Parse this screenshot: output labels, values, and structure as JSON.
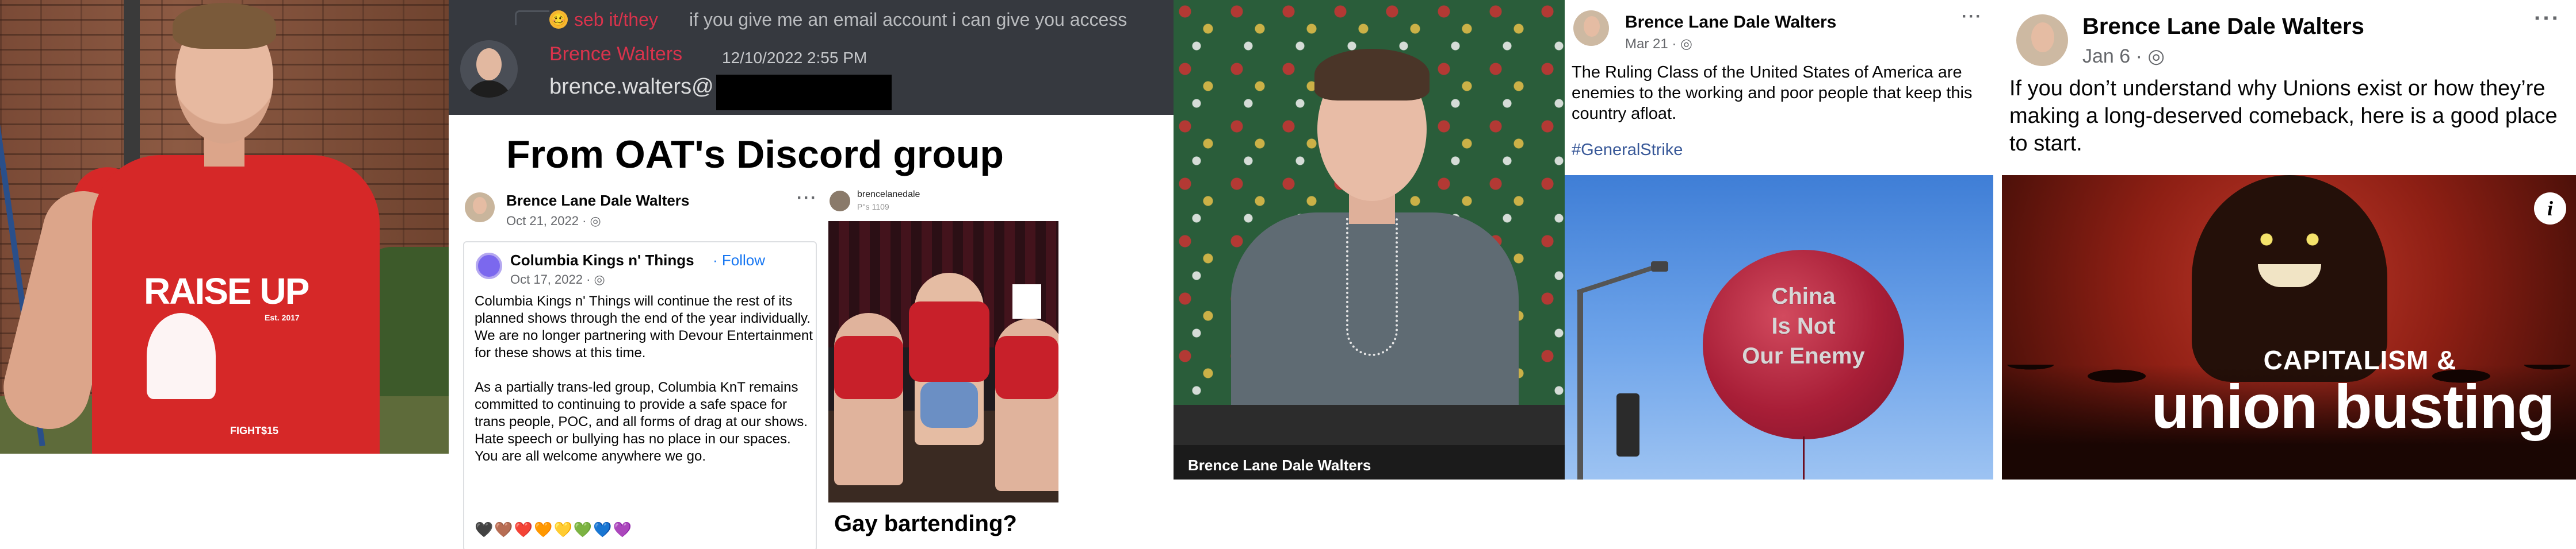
{
  "panel_discord": {
    "reply_emoji": "🥴",
    "reply_author": "seb it/they",
    "reply_text": "if you give me an email account i can give you access",
    "author": "Brence Walters",
    "timestamp": "12/10/2022 2:55 PM",
    "message": "brence.walters@"
  },
  "panel_oat": {
    "heading": "From OAT's Discord group",
    "fb_post": {
      "author": "Brence Lane Dale Walters",
      "meta": "Oct 21, 2022 · ",
      "more": "···",
      "shared": {
        "page_name": "Columbia Kings n' Things",
        "follow_label": "· Follow",
        "meta": "Oct 17, 2022 · ",
        "body": "Columbia Kings n' Things will continue the rest of its planned shows through the end of the year individually. We are no longer partnering with Devour Entertainment for these shows at this time.\n\nAs a partially trans-led group, Columbia KnT remains committed to continuing to provide a safe space for trans people, POC, and all forms of drag at our shows. Hate speech or bullying has no place in our spaces. You are all welcome anywhere we go.",
        "hearts": "🖤🤎❤️🧡💛💚💙💜"
      }
    },
    "ig_post": {
      "username": "brencelanedale",
      "meta": "P''s 1109",
      "caption": "Gay bartending?"
    }
  },
  "panel_video": {
    "caption": "Brence Lane Dale Walters"
  },
  "panel_post_balloon": {
    "author": "Brence Lane Dale Walters",
    "meta": "Mar 21 · ",
    "more": "···",
    "body": "The Ruling Class of the United States of America are enemies to the working and poor people that keep this country afloat.",
    "hashtag": "#GeneralStrike",
    "balloon_text": "China\nIs Not\nOur Enemy"
  },
  "panel_post_union": {
    "author": "Brence Lane Dale Walters",
    "meta": "Jan 6 · ",
    "more": "···",
    "body": "If you don’t understand why Unions exist or how they’re making a long-deserved comeback, here is a good place to start.",
    "info_glyph": "i",
    "image_caption_small": "CAPITALISM &",
    "image_caption_large": "union busting"
  },
  "panel_photo": {
    "shirt_text": "RAISE UP",
    "shirt_sub": "Est. 2017",
    "shirt_small": "FIGHT$15"
  }
}
